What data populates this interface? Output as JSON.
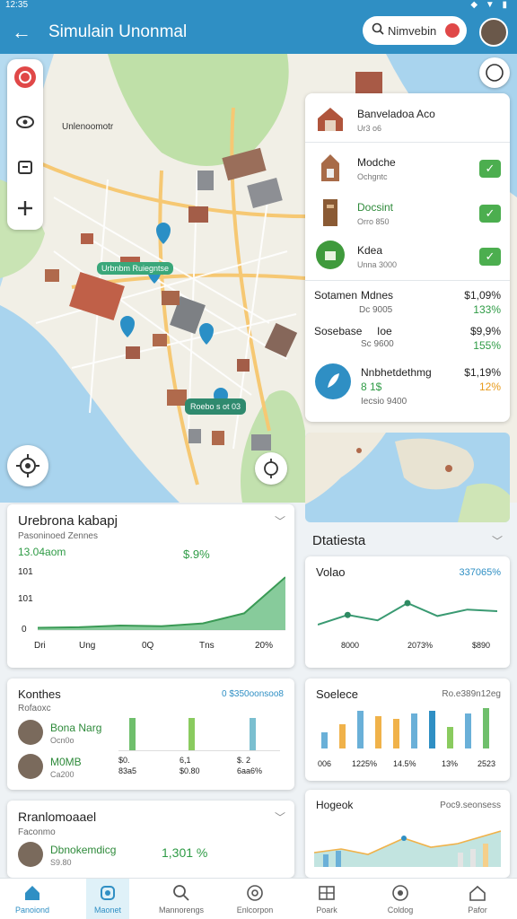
{
  "status": {
    "time": "12:35",
    "icons": "◆ ▼ ▮"
  },
  "appbar": {
    "title": "Simulain Unonmal",
    "search_label": "Nimvebin"
  },
  "map": {
    "city_label": "Unlenoomotr",
    "marker_label_1": "Urbnbm Ruiegntse",
    "marker_label_2": "Roebo s ot 03"
  },
  "places": [
    {
      "name": "Banveladoa Aco",
      "sub": "Ur3 o6",
      "color": "#b0553c",
      "checked": false
    },
    {
      "name": "Modche",
      "sub": "Ochgntc",
      "color": "#a86b48",
      "checked": true
    },
    {
      "name": "Docsint",
      "sub": "Orro 850",
      "color": "#8a5a34",
      "checked": true,
      "name_color": "#2e8a3a"
    },
    {
      "name": "Kdea",
      "sub": "Unna 3000",
      "color": "#3f9a3c",
      "checked": true
    }
  ],
  "summaries": [
    {
      "label": "Sotamen",
      "label2": "Mdnes",
      "sub": "Dc 9005",
      "value": "$1,09%",
      "delta": "133%",
      "delta_color": "#2e9b45"
    },
    {
      "label": "Sosebase",
      "label2": "Ioe",
      "sub": "Sc 9600",
      "value": "$9,9%",
      "delta": "155%",
      "delta_color": "#2e9b45"
    },
    {
      "label": "Nnbhetdethmg",
      "label2": "",
      "sub": "Iecsio 9400",
      "value": "$1,19%",
      "delta": "12%",
      "delta_color": "#e89a1a",
      "green_value": "8 1$"
    }
  ],
  "cards": {
    "c1": {
      "title": "Urebrona kabapj",
      "sub": "Pasoninoed Zennes",
      "stat": "13.04aom",
      "change": "$.9%",
      "ylabels": [
        "0",
        "101",
        "101"
      ],
      "xlabels": [
        "Dri",
        "Ung",
        "0Q",
        "Tns",
        "20%"
      ]
    },
    "c2": {
      "title": "Dtatiesta"
    },
    "c3": {
      "title": "Volao",
      "value": "337065%",
      "xlabels": [
        "8000",
        "2073%",
        "$890"
      ]
    },
    "c4": {
      "title": "Konthes",
      "link": "0 $350oonsoo8",
      "sub": "Rofaoxc",
      "people": [
        {
          "name": "Bona Narg",
          "sub": "Ocn0o"
        },
        {
          "name": "M0MB",
          "sub": "Ca200"
        }
      ],
      "bar_labels": [
        [
          "$0.",
          "83a5"
        ],
        [
          "6,1",
          "$0.80"
        ],
        [
          "$. 2",
          "6aa6%"
        ]
      ]
    },
    "c5": {
      "title": "Soelece",
      "link": "Ro.e389n12eg",
      "xlabels": [
        "006",
        "1225%",
        "14.5%",
        "13%",
        "2523"
      ]
    },
    "c6": {
      "title": "Rranlomoaael",
      "sub": "Faconmo",
      "person": "Dbnokemdicg",
      "person_sub": "S9.80",
      "stat": "1,301 %"
    },
    "c7": {
      "title": "Hogeok",
      "link": "Poc9.seonsess"
    }
  },
  "chart_data": [
    {
      "type": "area",
      "x": [
        "Dri",
        "Ung",
        "0Q",
        "Tns",
        "20%"
      ],
      "series": [
        {
          "values": [
            4,
            5,
            8,
            7,
            12,
            30,
            95
          ]
        }
      ]
    },
    {
      "type": "line",
      "x": [
        "8000",
        "2073%",
        "$890"
      ],
      "series": [
        {
          "values": [
            30,
            48,
            38,
            70,
            46,
            58,
            55
          ]
        }
      ]
    },
    {
      "type": "bar",
      "categories": [
        "006",
        "1225%",
        "14.5%",
        "13%",
        "2523"
      ],
      "series": [
        {
          "values": [
            30,
            45,
            70,
            60,
            55,
            65,
            70,
            40,
            65,
            75
          ]
        }
      ]
    }
  ],
  "nav": [
    {
      "label": "Panoiond",
      "icon": "home-icon"
    },
    {
      "label": "Maonet",
      "icon": "pin-icon"
    },
    {
      "label": "Mannorengs",
      "icon": "search-icon"
    },
    {
      "label": "Enlcorpon",
      "icon": "target-icon"
    },
    {
      "label": "Poark",
      "icon": "grid-icon"
    },
    {
      "label": "Coldog",
      "icon": "settings-icon"
    },
    {
      "label": "Pafor",
      "icon": "house-outline-icon"
    }
  ],
  "colors": {
    "primary": "#2f8fc4",
    "green": "#2e9b45",
    "orange": "#e89a1a"
  }
}
